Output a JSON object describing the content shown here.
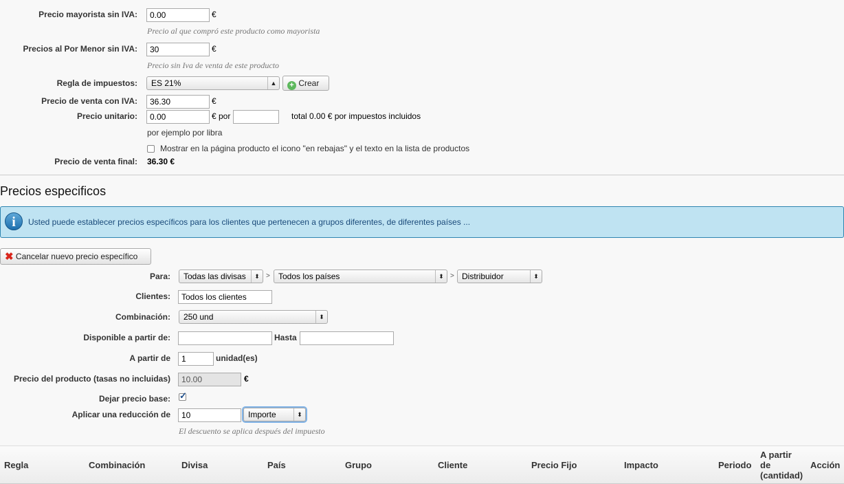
{
  "pricing": {
    "wholesale_label": "Precio mayorista sin IVA:",
    "wholesale_value": "0.00",
    "wholesale_currency": "€",
    "wholesale_hint": "Precio al que compró este producto como mayorista",
    "retail_label": "Precios al Por Menor sin IVA:",
    "retail_value": "30",
    "retail_currency": "€",
    "retail_hint": "Precio sin Iva de venta de este producto",
    "tax_rule_label": "Regla de impuestos:",
    "tax_rule_value": "ES 21%",
    "create_label": "Crear",
    "sale_price_label": "Precio de venta con IVA:",
    "sale_price_value": "36.30",
    "sale_price_currency": "€",
    "unit_price_label": "Precio unitario:",
    "unit_price_value": "0.00",
    "unit_price_per": "€ por",
    "unit_price_unit_value": "",
    "unit_total_text": "total 0.00 € por impuestos incluidos",
    "unit_hint": "por ejemplo por libra",
    "on_sale_text": "Mostrar en la página producto el icono \"en rebajas\" y el texto en la lista de productos",
    "final_price_label": "Precio de venta final:",
    "final_price_value": "36.30 €"
  },
  "specific": {
    "title": "Precios especificos",
    "info_text": "Usted puede establecer precios específicos para los clientes que pertenecen a grupos diferentes, de diferentes países ...",
    "cancel_label": "Cancelar nuevo precio específico",
    "para_label": "Para:",
    "currency_select": "Todas las divisas",
    "country_select": "Todos los países",
    "group_select": "Distribuidor",
    "gt": ">",
    "clients_label": "Clientes:",
    "clients_value": "Todos los clientes",
    "combination_label": "Combinación:",
    "combination_value": "250 und",
    "available_label": "Disponible a partir de:",
    "available_from": "",
    "until_label": "Hasta",
    "available_until": "",
    "from_qty_label": "A partir de",
    "from_qty_value": "1",
    "units_label": "unidad(es)",
    "product_price_label": "Precio del producto (tasas no incluidas)",
    "product_price_value": "10.00",
    "product_price_currency": "€",
    "keep_base_label": "Dejar precio base:",
    "keep_base_checked": true,
    "reduction_label": "Aplicar una reducción de",
    "reduction_value": "10",
    "reduction_type": "Importe",
    "reduction_hint": "El descuento se aplica después del impuesto"
  },
  "table": {
    "headers": [
      "Regla",
      "Combinación",
      "Divisa",
      "País",
      "Grupo",
      "Cliente",
      "Precio Fijo",
      "Impacto",
      "Periodo",
      "A partir de (cantidad)",
      "Acción"
    ],
    "from_qty_lines": [
      "A partir",
      "de",
      "(cantidad)"
    ]
  },
  "colors": {
    "info_bg": "#bfe3f2",
    "info_border": "#2e84b0",
    "info_text": "#1a4a7a"
  },
  "icons": {
    "info": "info-icon",
    "add": "plus-circle-icon",
    "cancel": "red-x-icon",
    "checkbox": "checkmark-icon"
  }
}
